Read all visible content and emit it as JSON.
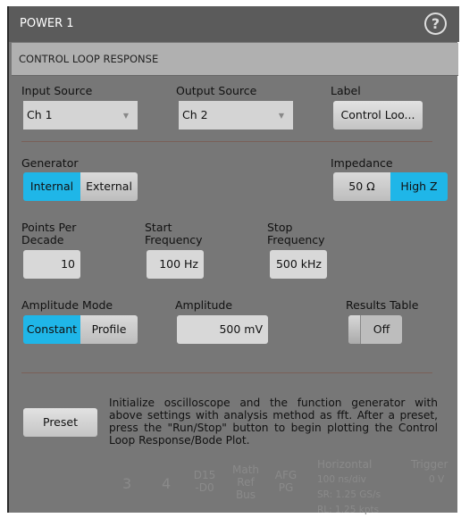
{
  "window": {
    "title": "POWER 1",
    "help_icon": "question-circle-icon",
    "section": "CONTROL LOOP RESPONSE"
  },
  "input_source": {
    "label": "Input Source",
    "value": "Ch 1"
  },
  "output_source": {
    "label": "Output Source",
    "value": "Ch 2"
  },
  "label": {
    "label": "Label",
    "value": "Control Loo..."
  },
  "generator": {
    "label": "Generator",
    "options": [
      "Internal",
      "External"
    ],
    "selected": "Internal"
  },
  "impedance": {
    "label": "Impedance",
    "options": [
      "50 Ω",
      "High Z"
    ],
    "selected": "High Z"
  },
  "points_per_decade": {
    "label": "Points Per Decade",
    "value": "10"
  },
  "start_frequency": {
    "label": "Start Frequency",
    "value": "100 Hz"
  },
  "stop_frequency": {
    "label": "Stop Frequency",
    "value": "500 kHz"
  },
  "amplitude_mode": {
    "label": "Amplitude Mode",
    "options": [
      "Constant",
      "Profile"
    ],
    "selected": "Constant"
  },
  "amplitude": {
    "label": "Amplitude",
    "value": "500 mV"
  },
  "results_table": {
    "label": "Results Table",
    "value": "Off"
  },
  "preset": {
    "label": "Preset",
    "description": "Initialize oscilloscope and the function generator with above settings with analysis method as fft. After a preset, press the \"Run/Stop\" button to begin plotting the Control Loop Response/Bode Plot."
  },
  "background": {
    "ch3": "3",
    "ch4": "4",
    "digital": "D15 -D0",
    "math": "Math Ref Bus",
    "afg": "AFG PG",
    "horizontal": "Horizontal",
    "hscale": "100 ns/div",
    "sr": "SR: 1.25 GS/s",
    "rl": "RL: 1.25 kpts",
    "trigger": "Trigger",
    "trig_level": "0 V"
  },
  "colors": {
    "accent": "#1fb6e8",
    "title_bar": "#5b5b5b",
    "panel": "#777777"
  }
}
